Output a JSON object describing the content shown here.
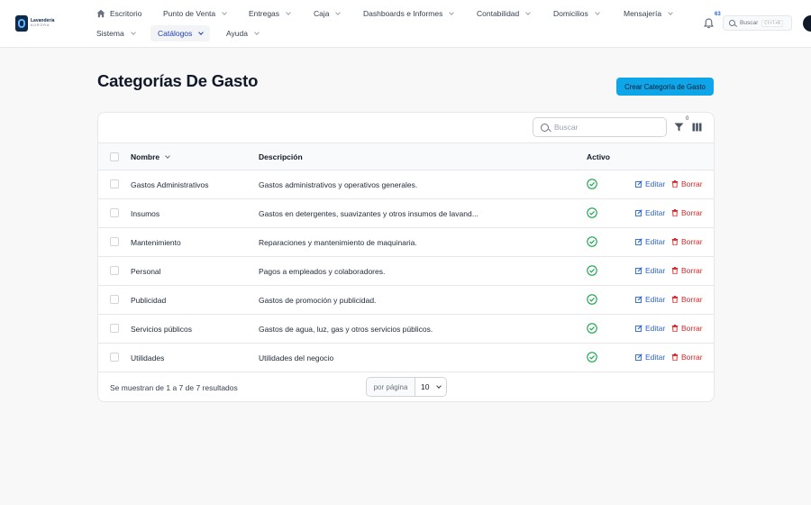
{
  "brand": {
    "line1": "Lavandería",
    "line2": "AURORA"
  },
  "nav": {
    "row1": [
      {
        "label": "Escritorio"
      },
      {
        "label": "Punto de Venta"
      },
      {
        "label": "Entregas"
      },
      {
        "label": "Caja"
      },
      {
        "label": "Dashboards e Informes"
      },
      {
        "label": "Contabilidad"
      },
      {
        "label": "Domicilios"
      },
      {
        "label": "Mensajería"
      }
    ],
    "row2": [
      {
        "label": "Sistema"
      },
      {
        "label": "Catálogos"
      },
      {
        "label": "Ayuda"
      }
    ]
  },
  "notifications": {
    "count": "63"
  },
  "global_search": {
    "placeholder": "Buscar",
    "shortcut": "Ctrl+K"
  },
  "page": {
    "title": "Categorías De Gasto",
    "create_button": "Crear Categoría de Gasto"
  },
  "table": {
    "search_placeholder": "Buscar",
    "filter_count": "0",
    "columns": {
      "name": "Nombre",
      "description": "Descripción",
      "active": "Activo"
    },
    "edit_label": "Editar",
    "delete_label": "Borrar",
    "rows": [
      {
        "name": "Gastos Administrativos",
        "description": "Gastos administrativos y operativos generales.",
        "active": true
      },
      {
        "name": "Insumos",
        "description": "Gastos en detergentes, suavizantes y otros insumos de lavand...",
        "active": true
      },
      {
        "name": "Mantenimiento",
        "description": "Reparaciones y mantenimiento de maquinaria.",
        "active": true
      },
      {
        "name": "Personal",
        "description": "Pagos a empleados y colaboradores.",
        "active": true
      },
      {
        "name": "Publicidad",
        "description": "Gastos de promoción y publicidad.",
        "active": true
      },
      {
        "name": "Servicios públicos",
        "description": "Gastos de agua, luz, gas y otros servicios públicos.",
        "active": true
      },
      {
        "name": "Utilidades",
        "description": "Utilidades del negocio",
        "active": true
      }
    ],
    "footer_text": "Se muestran de 1 a 7 de 7 resultados",
    "per_page_label": "por página",
    "per_page_value": "10"
  },
  "colors": {
    "accent": "#0ea5e9",
    "link": "#2563eb",
    "danger": "#dc2626",
    "success": "#16a34a"
  }
}
